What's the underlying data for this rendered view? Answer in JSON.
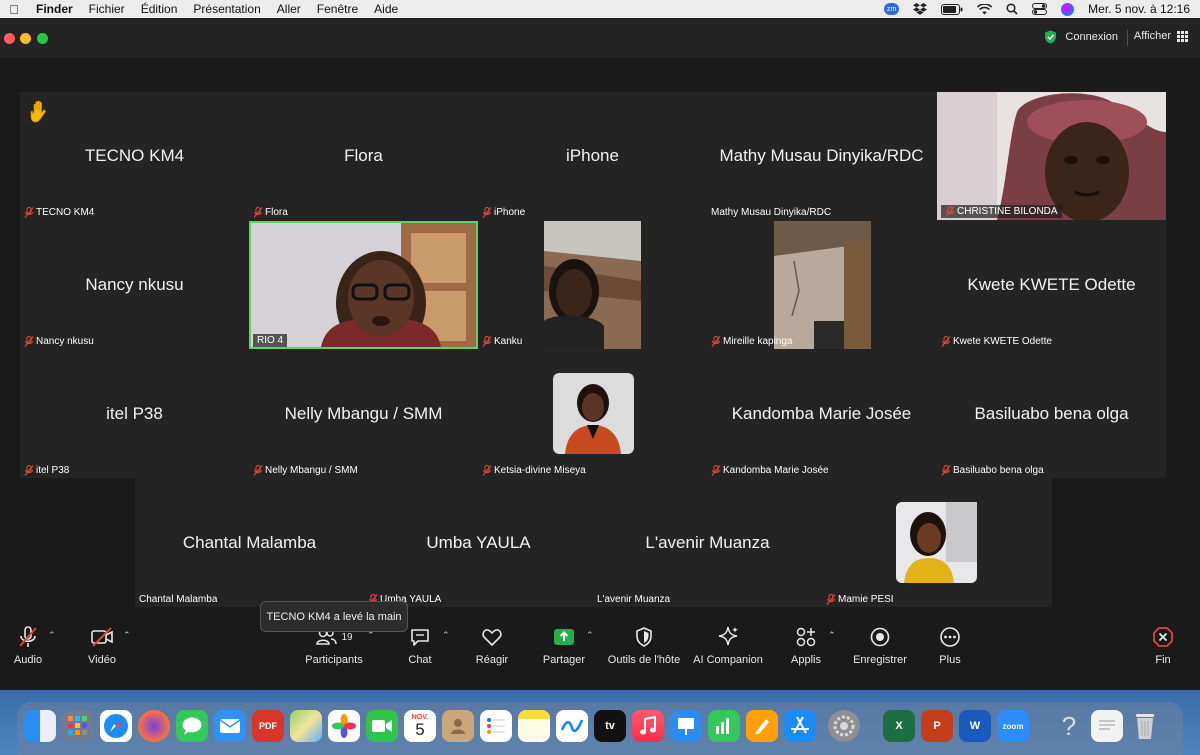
{
  "menubar": {
    "items": [
      "Finder",
      "Fichier",
      "Édition",
      "Présentation",
      "Aller",
      "Fenêtre",
      "Aide"
    ],
    "clock": "Mer. 5 nov. à 12:16",
    "zoom_badge": "zm"
  },
  "window": {
    "connexion_label": "Connexion",
    "afficher_label": "Afficher"
  },
  "tiles": {
    "tecno": {
      "name": "TECNO KM4",
      "label": "TECNO KM4"
    },
    "flora": {
      "name": "Flora",
      "label": "Flora"
    },
    "iphone": {
      "name": "iPhone",
      "label": "iPhone"
    },
    "mathy": {
      "name": "Mathy Musau Dinyika/RDC",
      "label": "Mathy Musau Dinyika/RDC"
    },
    "christine": {
      "label": "CHRISTINE BILONDA"
    },
    "nancy": {
      "name": "Nancy nkusu",
      "label": "Nancy nkusu"
    },
    "rio": {
      "label": "RIO 4"
    },
    "kanku": {
      "label": "Kanku"
    },
    "mireille": {
      "label": "Mireille kapinga"
    },
    "kwete": {
      "name": "Kwete KWETE Odette",
      "label": "Kwete KWETE Odette"
    },
    "itel": {
      "name": "itel P38",
      "label": "itel P38"
    },
    "nelly": {
      "name": "Nelly Mbangu / SMM",
      "label": "Nelly Mbangu / SMM"
    },
    "ketsia": {
      "label": "Ketsia-divine Miseya"
    },
    "kandomba": {
      "name": "Kandomba Marie Josée",
      "label": "Kandomba Marie Josée"
    },
    "basiluabo": {
      "name": "Basiluabo bena olga",
      "label": "Basiluabo bena olga"
    },
    "chantal": {
      "name": "Chantal Malamba",
      "label": "Chantal Malamba"
    },
    "umba": {
      "name": "Umba YAULA",
      "label": "Umba YAULA"
    },
    "lavenir": {
      "name": "L'avenir Muanza",
      "label": "L'avenir Muanza"
    },
    "mamie": {
      "label": "Mamie PESI"
    }
  },
  "tooltip": "TECNO KM4 a levé la main",
  "toolbar": {
    "audio": "Audio",
    "video": "Vidéo",
    "participants": "Participants",
    "participants_count": "19",
    "chat": "Chat",
    "react": "Réagir",
    "share": "Partager",
    "host_tools": "Outils de l'hôte",
    "ai_companion": "AI Companion",
    "apps": "Applis",
    "record": "Enregistrer",
    "more": "Plus",
    "end": "Fin"
  },
  "dock": {
    "calendar_month": "NOV.",
    "calendar_day": "5",
    "tv_label": "tv",
    "zoom_label": "zoom",
    "pdf_label": "PDF"
  },
  "colors": {
    "active_speaker_border": "#5fd35f",
    "mute_red": "#e0453c",
    "tile_bg": "#242424",
    "share_green": "#22b14c"
  }
}
